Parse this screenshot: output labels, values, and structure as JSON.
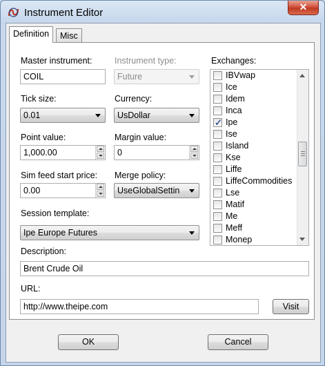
{
  "window": {
    "title": "Instrument Editor",
    "close_glyph": "✕"
  },
  "tabs": {
    "definition": "Definition",
    "misc": "Misc"
  },
  "master_instrument": {
    "label": "Master instrument:",
    "value": "COIL"
  },
  "instrument_type": {
    "label": "Instrument type:",
    "value": "Future"
  },
  "tick_size": {
    "label": "Tick size:",
    "value": "0.01"
  },
  "currency": {
    "label": "Currency:",
    "value": "UsDollar"
  },
  "point_value": {
    "label": "Point value:",
    "value": "1,000.00"
  },
  "margin_value": {
    "label": "Margin value:",
    "value": "0"
  },
  "sim_feed": {
    "label": "Sim feed start price:",
    "value": "0.00"
  },
  "merge_policy": {
    "label": "Merge policy:",
    "value": "UseGlobalSettin"
  },
  "session_template": {
    "label": "Session template:",
    "value": "Ipe Europe Futures"
  },
  "exchanges": {
    "label": "Exchanges:",
    "items": [
      {
        "name": "IBVwap",
        "checked": false
      },
      {
        "name": "Ice",
        "checked": false
      },
      {
        "name": "Idem",
        "checked": false
      },
      {
        "name": "Inca",
        "checked": false
      },
      {
        "name": "Ipe",
        "checked": true
      },
      {
        "name": "Ise",
        "checked": false
      },
      {
        "name": "Island",
        "checked": false
      },
      {
        "name": "Kse",
        "checked": false
      },
      {
        "name": "Liffe",
        "checked": false
      },
      {
        "name": "LiffeCommodities",
        "checked": false
      },
      {
        "name": "Lse",
        "checked": false
      },
      {
        "name": "Matif",
        "checked": false
      },
      {
        "name": "Me",
        "checked": false
      },
      {
        "name": "Meff",
        "checked": false
      },
      {
        "name": "Monep",
        "checked": false
      }
    ]
  },
  "description": {
    "label": "Description:",
    "value": "Brent Crude Oil"
  },
  "url": {
    "label": "URL:",
    "value": "http://www.theipe.com",
    "visit_label": "Visit"
  },
  "footer": {
    "ok_label": "OK",
    "cancel_label": "Cancel"
  },
  "colors": {
    "close_button": "#c13a22",
    "title_bar": "#c7d8ec",
    "check_mark": "#3a5a9a"
  }
}
